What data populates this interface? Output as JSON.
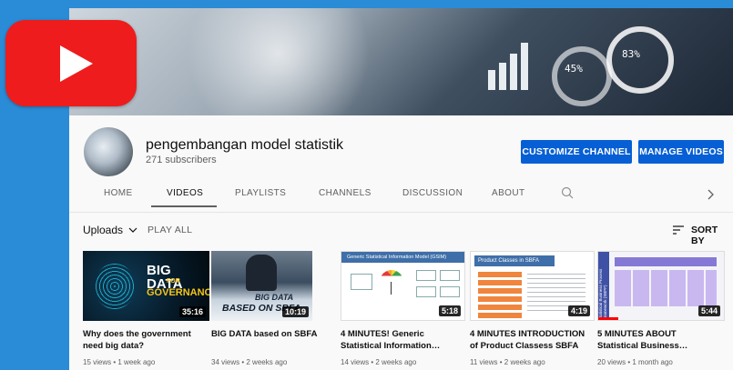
{
  "channel": {
    "name": "pengembangan model statistik",
    "subscribers": "271 subscribers",
    "customize_label": "CUSTOMIZE CHANNEL",
    "manage_label": "MANAGE VIDEOS"
  },
  "banner": {
    "ring1_text": "45%",
    "ring2_text": "83%"
  },
  "tabs": [
    {
      "label": "HOME"
    },
    {
      "label": "VIDEOS"
    },
    {
      "label": "PLAYLISTS"
    },
    {
      "label": "CHANNELS"
    },
    {
      "label": "DISCUSSION"
    },
    {
      "label": "ABOUT"
    }
  ],
  "section": {
    "uploads_label": "Uploads",
    "play_all_label": "PLAY ALL",
    "sort_label": "SORT BY"
  },
  "videos": [
    {
      "title_line1": "Why does the government",
      "title_line2": "need big data?",
      "meta": "15 views • 1 week ago",
      "duration": "35:16",
      "thumb_text1": "BIG DATA",
      "thumb_text2": "FOR",
      "thumb_text3": "GOVERNANCE"
    },
    {
      "title_line1": "BIG DATA based on SBFA",
      "title_line2": "",
      "meta": "34 views • 2 weeks ago",
      "duration": "10:19",
      "thumb_text1": "BIG DATA",
      "thumb_text2": "BASED ON SBFA"
    },
    {
      "title_line1": "4 MINUTES! Generic",
      "title_line2": "Statistical Information…",
      "meta": "14 views • 2 weeks ago",
      "duration": "5:18",
      "thumb_text1": "Generic Statistical Information Model (GSIM)"
    },
    {
      "title_line1": "4 MINUTES INTRODUCTION",
      "title_line2": "of Product Classess SBFA",
      "meta": "11 views • 2 weeks ago",
      "duration": "4:19",
      "thumb_text1": "Product Classes in SBFA"
    },
    {
      "title_line1": "5 MINUTES ABOUT",
      "title_line2": "Statistical Business…",
      "meta": "20 views • 1 month ago",
      "duration": "5:44",
      "thumb_text1": "Statistical Business Process Framework (SBPF)"
    }
  ]
}
